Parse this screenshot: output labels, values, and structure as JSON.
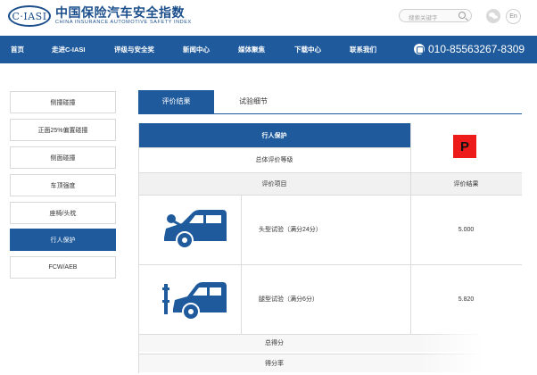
{
  "header": {
    "logo_text": "C·IASI",
    "brand_cn": "中国保险汽车安全指数",
    "brand_en": "CHINA INSURANCE AUTOMOTIVE SAFETY INDEX",
    "search_placeholder": "搜索关键字",
    "lang_label": "En",
    "icons": [
      "search-icon",
      "wechat-icon"
    ]
  },
  "nav": {
    "items": [
      "首页",
      "走进C-IASI",
      "评级与安全奖",
      "新闻中心",
      "媒体聚焦",
      "下载中心",
      "联系我们"
    ],
    "phone": "010-85563267-8309"
  },
  "sidebar": {
    "items": [
      "侧撞碰撞",
      "正面25%偏置碰撞",
      "侧面碰撞",
      "车顶强度",
      "座椅/头枕",
      "行人保护",
      "FCW/AEB"
    ],
    "active_index": 5
  },
  "tabs": {
    "items": [
      "评价结果",
      "试验细节"
    ],
    "active_index": 0
  },
  "table": {
    "section_title": "行人保护",
    "overall_label": "总体评价等级",
    "rating": "P",
    "rating_color": "#ee1b1b",
    "col_item": "评价项目",
    "col_result": "评价结果",
    "rows": [
      {
        "label": "头型试验（满分24分）",
        "value": "5.000"
      },
      {
        "label": "腿型试验（满分6分）",
        "value": "5.820"
      }
    ],
    "total_label": "总得分",
    "rate_label": "得分率"
  },
  "colors": {
    "primary": "#1e5a9c",
    "rating_poor": "#ee1b1b"
  }
}
